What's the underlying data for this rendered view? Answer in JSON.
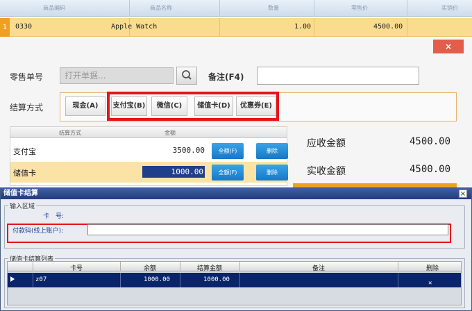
{
  "top_grid": {
    "headers": [
      "商品编码",
      "商品名称",
      "数量",
      "零售价",
      "实销价"
    ],
    "row": {
      "index": "1",
      "code": "0330",
      "name": "Apple Watch",
      "qty": "1.00",
      "price": "4500.00"
    }
  },
  "close_label": "×",
  "form": {
    "order_no_label": "零售单号",
    "order_no_placeholder": "打开单据...",
    "remark_label": "备注(F4)",
    "remark_value": "",
    "settle_label": "结算方式",
    "methods": [
      "现金(A)",
      "支付宝(B)",
      "微信(C)",
      "储值卡(D)",
      "优惠券(E)"
    ]
  },
  "payment_table": {
    "headers": [
      "结算方式",
      "金额"
    ],
    "rows": [
      {
        "method": "支付宝",
        "amount": "3500.00",
        "all_label": "全额(F)",
        "delete_label": "删除"
      },
      {
        "method": "储值卡",
        "amount": "1000.00",
        "all_label": "全额(F)",
        "delete_label": "删除"
      }
    ]
  },
  "summary": {
    "receivable_label": "应收金额",
    "receivable_value": "4500.00",
    "received_label": "实收金额",
    "received_value": "4500.00"
  },
  "card_dialog": {
    "title": "储值卡结算",
    "input_group": "输入区域",
    "card_no_label": "卡　号:",
    "pay_code_label": "付款码(线上账户):",
    "pay_code_value": "",
    "list_group": "储值卡结算列表",
    "columns": [
      "卡号",
      "余额",
      "结算金额",
      "备注",
      "删除"
    ],
    "rows": [
      {
        "card_no": "z07",
        "balance": "1000.00",
        "settle_amount": "1000.00",
        "remark": ""
      }
    ]
  },
  "colors": {
    "accent_red": "#e5141a",
    "selection_blue": "#0a246a",
    "row_highlight": "#f9dc8e"
  }
}
